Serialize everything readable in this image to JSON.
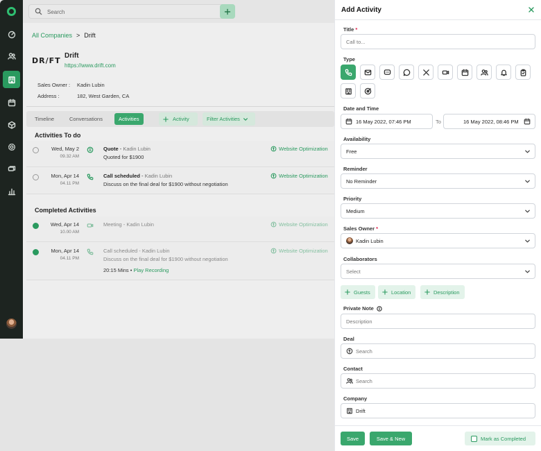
{
  "topbar": {
    "search_placeholder": "Search"
  },
  "breadcrumb": {
    "root": "All Companies",
    "separator": ">",
    "current": "Drift"
  },
  "company": {
    "logo_text": "DR/FT",
    "name": "Drift",
    "url": "https://www.drift.com",
    "sales_owner_label": "Sales Owner :",
    "sales_owner": "Kadin Lubin",
    "address_label": "Address :",
    "address": "182, West Garden, CA"
  },
  "tabs": {
    "timeline": "Timeline",
    "conversations": "Conversations",
    "activities": "Activities",
    "add_activity": "Activity",
    "filter": "Filter Activities"
  },
  "todo": {
    "title": "Activities To do",
    "items": [
      {
        "date": "Wed, May 2",
        "time": "09.32 AM",
        "title": "Quote",
        "who": "Kadin Lubin",
        "desc": "Quoted for $1900",
        "tag": "Website Optimization"
      },
      {
        "date": "Mon, Apr 14",
        "time": "04.11 PM",
        "title": "Call scheduled",
        "who": "Kadin Lubin",
        "desc": "Discuss on the final deal for $1900 without negotiation",
        "tag": "Website Optimization"
      }
    ]
  },
  "completed": {
    "title": "Completed Activities",
    "items": [
      {
        "date": "Wed, Apr 14",
        "time": "10.00 AM",
        "title": "Meeting",
        "who": "Kadin Lubin",
        "desc": "",
        "tag": "Website Optimization"
      },
      {
        "date": "Mon, Apr 14",
        "time": "04.11 PM",
        "title": "Call scheduled",
        "who": "Kadin Lubin",
        "desc": "Discuss on the final deal for $1900 without negotiation",
        "duration": "20:15 Mins",
        "recording": "Play Recording",
        "tag": "Website Optimization"
      }
    ]
  },
  "drawer": {
    "title": "Add Activity",
    "title_label": "Title",
    "title_placeholder": "Call to...",
    "type_label": "Type",
    "datetime_label": "Date and Time",
    "start": "16 May 2022, 07:46 PM",
    "to_label": "To",
    "end": "16 May 2022, 08:46 PM",
    "availability_label": "Availability",
    "availability": "Free",
    "reminder_label": "Reminder",
    "reminder": "No Reminder",
    "priority_label": "Priority",
    "priority": "Medium",
    "sales_owner_label": "Sales Owner",
    "sales_owner": "Kadin Lubin",
    "collaborators_label": "Collaborators",
    "collaborators_placeholder": "Select",
    "chips": {
      "guests": "Guests",
      "location": "Location",
      "description": "Description"
    },
    "private_note_label": "Private Note",
    "private_note_placeholder": "Description",
    "deal_label": "Deal",
    "deal_placeholder": "Search",
    "contact_label": "Contact",
    "contact_placeholder": "Search",
    "company_label": "Company",
    "company": "Drift",
    "required_mark": "*",
    "save": "Save",
    "save_new": "Save & New",
    "mark_completed": "Mark as Completed"
  },
  "colors": {
    "accent": "#3aa76d",
    "sidebar": "#1d2420",
    "required": "#e11d48"
  }
}
